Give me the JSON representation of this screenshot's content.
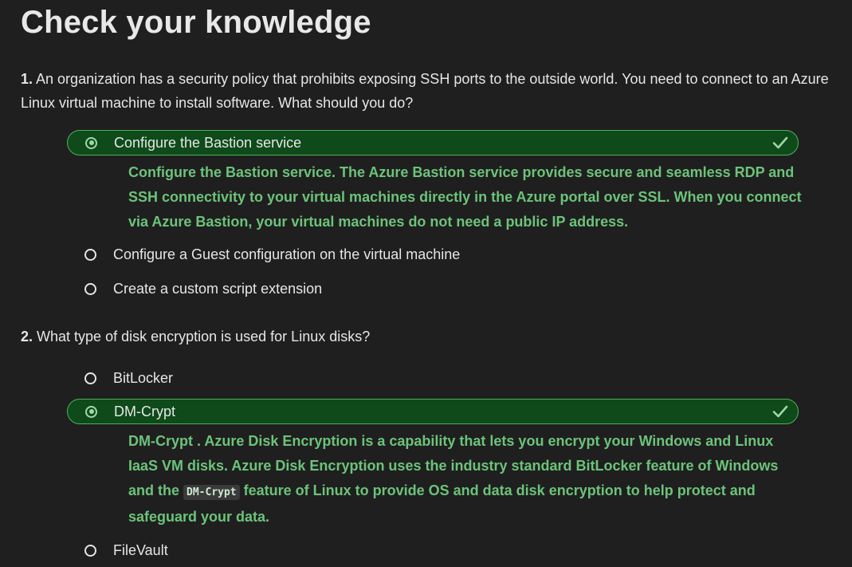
{
  "page": {
    "title": "Check your knowledge"
  },
  "colors": {
    "background": "#1f1f1f",
    "correct_fill": "#0e4a1a",
    "correct_border": "#4fb05a",
    "explanation_text": "#6cc37a"
  },
  "questions": [
    {
      "number": "1.",
      "text": "An organization has a security policy that prohibits exposing SSH ports to the outside world. You need to connect to an Azure Linux virtual machine to install software. What should you do?",
      "options": [
        {
          "label": "Configure the Bastion service",
          "selected": true,
          "correct": true,
          "icon": "check-icon"
        },
        {
          "label": "Configure a Guest configuration on the virtual machine",
          "selected": false
        },
        {
          "label": "Create a custom script extension",
          "selected": false
        }
      ],
      "explanation": "Configure the Bastion service. The Azure Bastion service provides secure and seamless RDP and SSH connectivity to your virtual machines directly in the Azure portal over SSL. When you connect via Azure Bastion, your virtual machines do not need a public IP address."
    },
    {
      "number": "2.",
      "text": "What type of disk encryption is used for Linux disks?",
      "options": [
        {
          "label": "BitLocker",
          "selected": false
        },
        {
          "label": "DM-Crypt",
          "selected": true,
          "correct": true,
          "icon": "check-icon"
        },
        {
          "label": "FileVault",
          "selected": false
        }
      ],
      "explanation": {
        "part1": "DM-Crypt . Azure Disk Encryption is a capability that lets you encrypt your Windows and Linux IaaS VM disks. Azure Disk Encryption uses the industry standard BitLocker feature of Windows and the ",
        "code": "DM-Crypt",
        "part2": " feature of Linux to provide OS and data disk encryption to help protect and safeguard your data."
      }
    }
  ]
}
